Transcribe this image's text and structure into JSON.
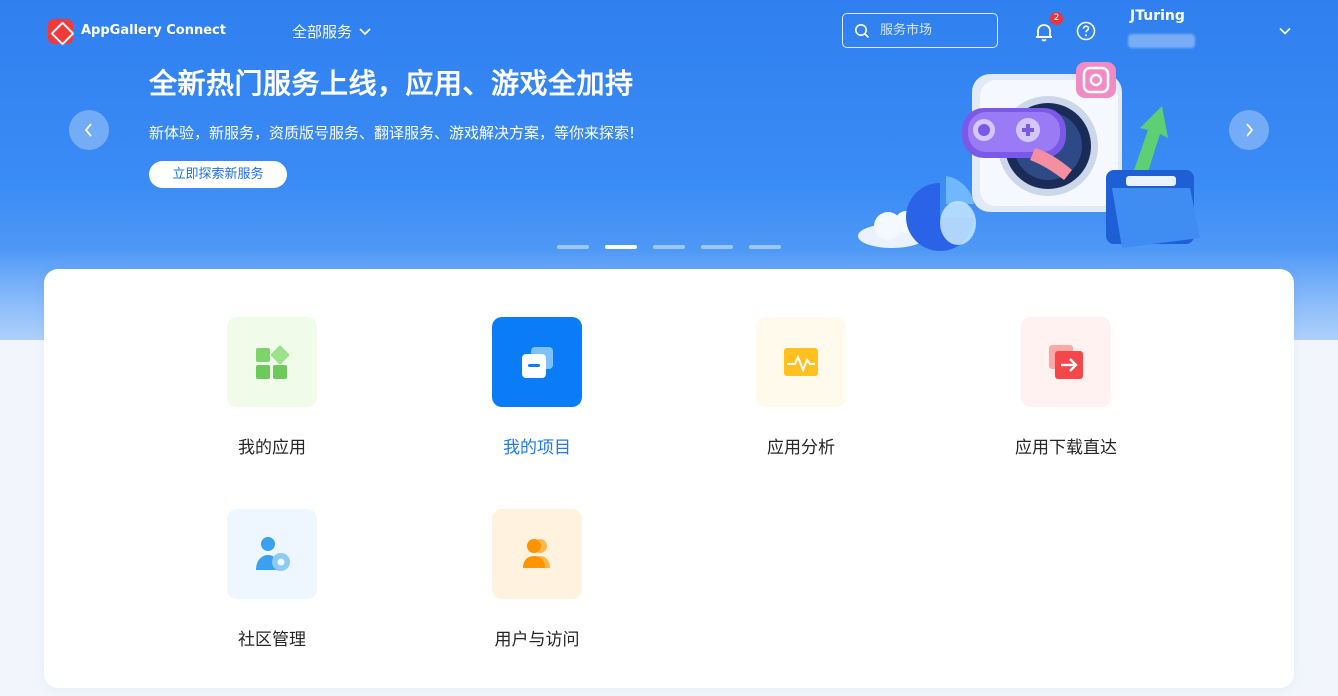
{
  "header": {
    "brand": "AppGallery Connect",
    "all_services_label": "全部服务",
    "search_placeholder": "服务市场",
    "notification_count": "2",
    "username": "JTuring"
  },
  "banner": {
    "title": "全新热门服务上线，应用、游戏全加持",
    "subtitle": "新体验，新服务，资质版号服务、翻译服务、游戏解决方案，等你来探索!",
    "button_label": "立即探索新服务",
    "slide_count": 5,
    "active_slide": 2
  },
  "services": [
    {
      "label": "我的应用",
      "icon": "grid-apps-icon",
      "bg": "#f1fbea",
      "active": false
    },
    {
      "label": "我的项目",
      "icon": "project-layers-icon",
      "bg": "#0b7cf7",
      "active": true
    },
    {
      "label": "应用分析",
      "icon": "analytics-pulse-icon",
      "bg": "#fffaeb",
      "active": false
    },
    {
      "label": "应用下载直达",
      "icon": "download-direct-icon",
      "bg": "#fff2f1",
      "active": false
    },
    {
      "label": "社区管理",
      "icon": "community-user-gear-icon",
      "bg": "#eef7ff",
      "active": false
    },
    {
      "label": "用户与访问",
      "icon": "users-access-icon",
      "bg": "#fff3e0",
      "active": false
    }
  ],
  "colors": {
    "primary": "#1f79e8",
    "hero_blue": "#2f7ff0",
    "badge": "#e8383d"
  }
}
